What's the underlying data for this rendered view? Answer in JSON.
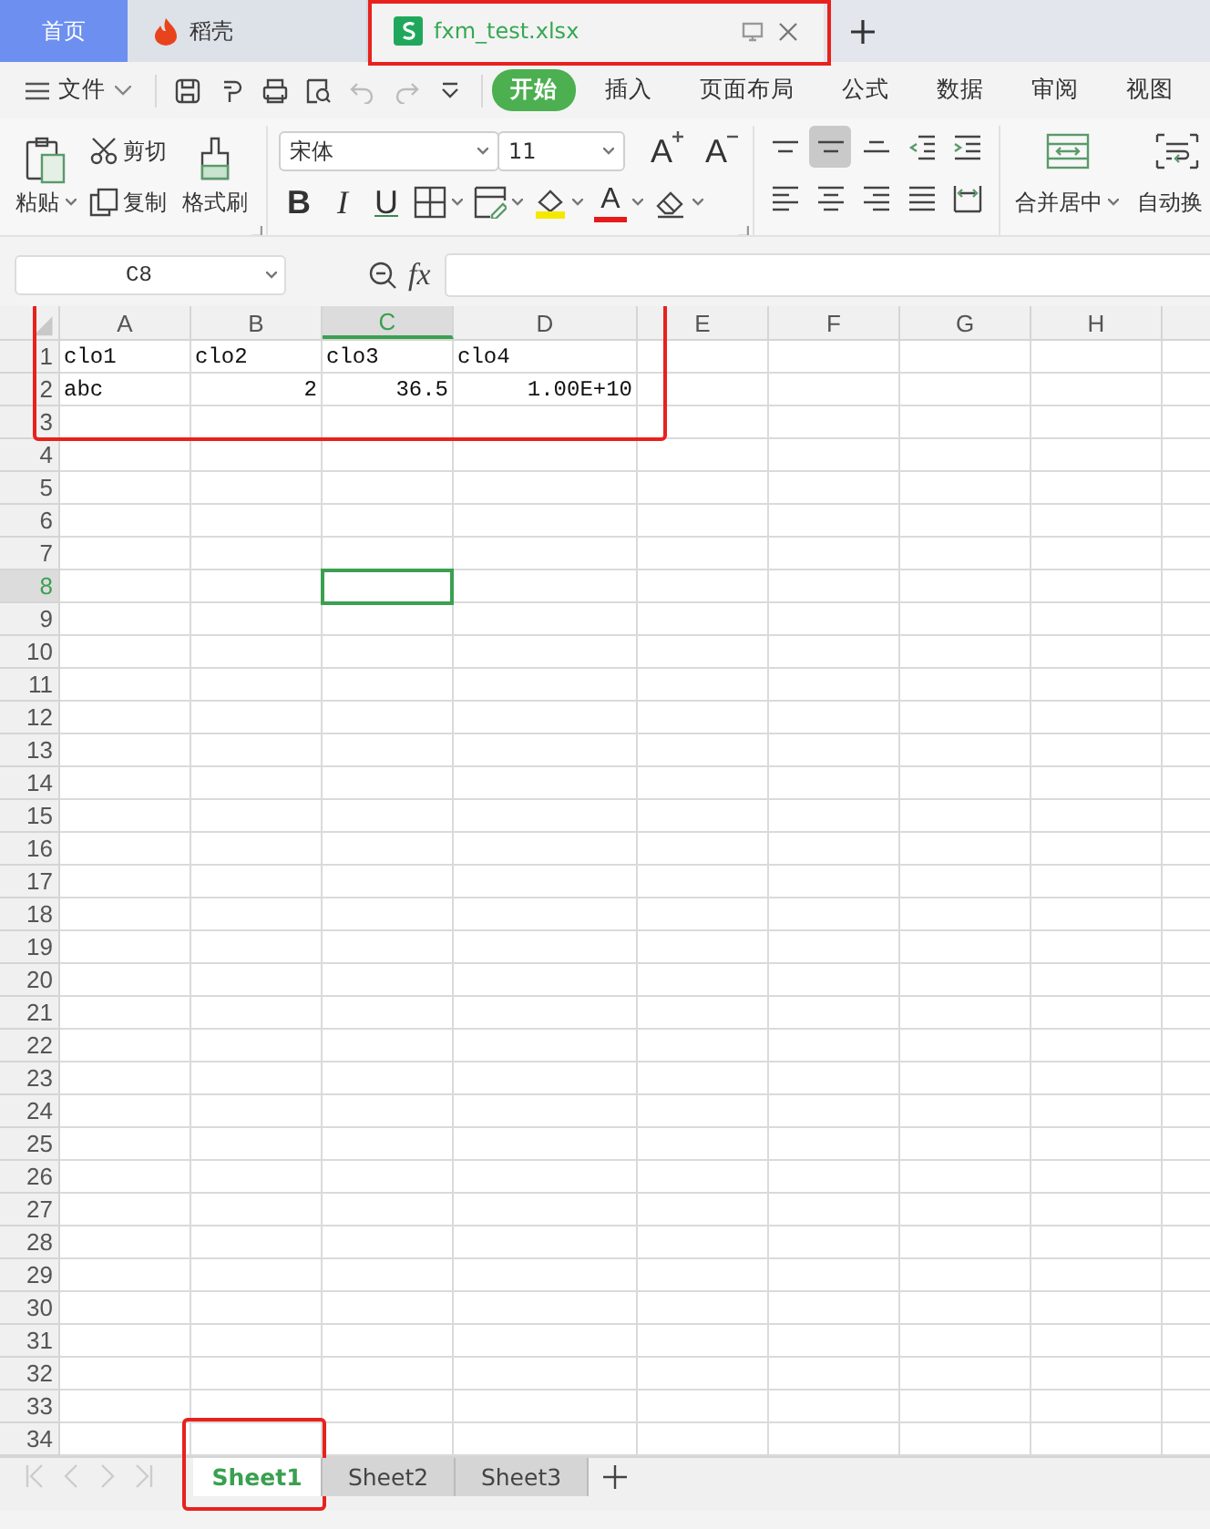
{
  "doc_tabs": [
    {
      "label": "首页",
      "kind": "home",
      "selected": false,
      "annotated": false
    },
    {
      "label": "稻壳",
      "kind": "app",
      "selected": false,
      "annotated": false
    },
    {
      "label": "fxm_test.xlsx",
      "kind": "file",
      "selected": true,
      "annotated": true
    }
  ],
  "menu": {
    "file_label": "文件"
  },
  "ribbon_tabs": [
    {
      "label": "开始",
      "selected": true
    },
    {
      "label": "插入",
      "selected": false
    },
    {
      "label": "页面布局",
      "selected": false
    },
    {
      "label": "公式",
      "selected": false
    },
    {
      "label": "数据",
      "selected": false
    },
    {
      "label": "审阅",
      "selected": false
    },
    {
      "label": "视图",
      "selected": false
    }
  ],
  "ribbon": {
    "paste": "粘贴",
    "cut": "剪切",
    "copy": "复制",
    "format_painter": "格式刷",
    "font": "宋体",
    "font_size": "11",
    "font_buttons": [
      {
        "kind": "grow",
        "text": "A"
      },
      {
        "kind": "shrink",
        "text": "A"
      }
    ],
    "style_buttons": [
      {
        "kind": "bold",
        "text": "B"
      },
      {
        "kind": "italic",
        "text": "I"
      },
      {
        "kind": "underline",
        "text": "U"
      }
    ],
    "font_color": "A",
    "vertical_align": [
      {
        "kind": "top",
        "selected": false
      },
      {
        "kind": "middle",
        "selected": true
      },
      {
        "kind": "bottom",
        "selected": false
      }
    ],
    "merge": "合并居中",
    "wrap": "自动换"
  },
  "formula_bar": {
    "name_box": "C8",
    "function_label": "fx"
  },
  "grid": {
    "annotated": true,
    "columns": [
      {
        "label": "A",
        "selected": false
      },
      {
        "label": "B",
        "selected": false
      },
      {
        "label": "C",
        "selected": true
      },
      {
        "label": "D",
        "selected": false
      },
      {
        "label": "E",
        "selected": false
      },
      {
        "label": "F",
        "selected": false
      },
      {
        "label": "G",
        "selected": false
      },
      {
        "label": "H",
        "selected": false
      }
    ],
    "rows": [
      {
        "number": "1",
        "selected": false,
        "cells": [
          {
            "text": "clo1",
            "kind": "text"
          },
          {
            "text": "clo2",
            "kind": "text"
          },
          {
            "text": "clo3",
            "kind": "text"
          },
          {
            "text": "clo4",
            "kind": "text"
          }
        ]
      },
      {
        "number": "2",
        "selected": false,
        "cells": [
          {
            "text": "abc",
            "kind": "text"
          },
          {
            "text": "2",
            "kind": "number"
          },
          {
            "text": "36.5",
            "kind": "number"
          },
          {
            "text": "1.00E+10",
            "kind": "number"
          }
        ]
      },
      {
        "number": "3",
        "selected": false
      },
      {
        "number": "4",
        "selected": false
      },
      {
        "number": "5",
        "selected": false
      },
      {
        "number": "6",
        "selected": false
      },
      {
        "number": "7",
        "selected": false
      },
      {
        "number": "8",
        "selected": true
      },
      {
        "number": "9",
        "selected": false
      },
      {
        "number": "10",
        "selected": false
      },
      {
        "number": "11",
        "selected": false
      },
      {
        "number": "12",
        "selected": false
      },
      {
        "number": "13",
        "selected": false
      },
      {
        "number": "14",
        "selected": false
      },
      {
        "number": "15",
        "selected": false
      },
      {
        "number": "16",
        "selected": false
      },
      {
        "number": "17",
        "selected": false
      },
      {
        "number": "18",
        "selected": false
      },
      {
        "number": "19",
        "selected": false
      },
      {
        "number": "20",
        "selected": false
      },
      {
        "number": "21",
        "selected": false
      },
      {
        "number": "22",
        "selected": false
      },
      {
        "number": "23",
        "selected": false
      },
      {
        "number": "24",
        "selected": false
      },
      {
        "number": "25",
        "selected": false
      },
      {
        "number": "26",
        "selected": false
      },
      {
        "number": "27",
        "selected": false
      },
      {
        "number": "28",
        "selected": false
      },
      {
        "number": "29",
        "selected": false
      },
      {
        "number": "30",
        "selected": false
      },
      {
        "number": "31",
        "selected": false
      },
      {
        "number": "32",
        "selected": false
      },
      {
        "number": "33",
        "selected": false
      },
      {
        "number": "34",
        "selected": false
      }
    ]
  },
  "sheet_tabs": [
    {
      "label": "Sheet1",
      "selected": true,
      "annotated": true
    },
    {
      "label": "Sheet2",
      "selected": false,
      "annotated": false
    },
    {
      "label": "Sheet3",
      "selected": false,
      "annotated": false
    }
  ]
}
